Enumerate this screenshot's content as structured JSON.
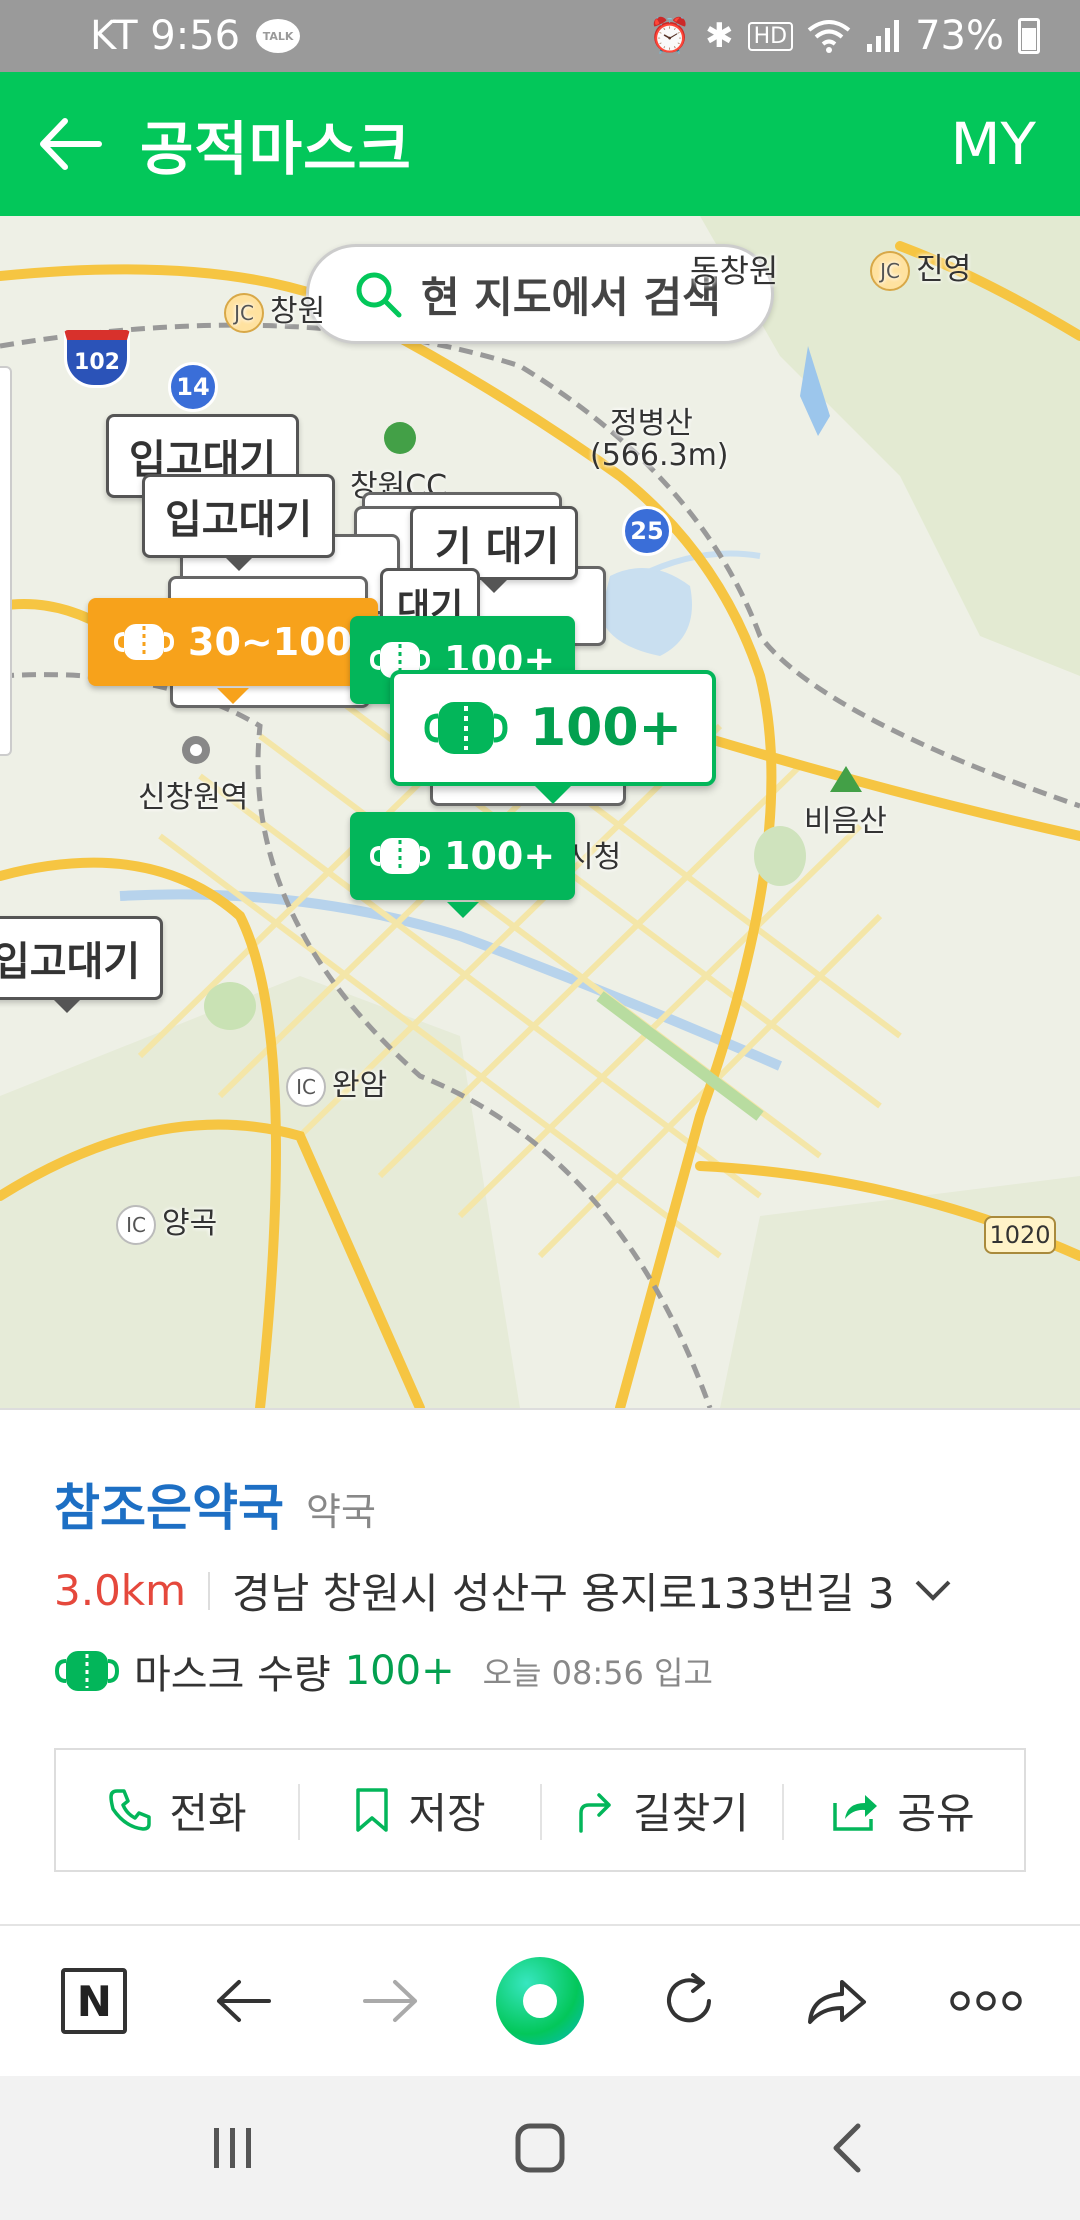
{
  "status_bar": {
    "carrier_time": "KT 9:56",
    "talk_badge": "TALK",
    "battery": "73%",
    "icons": [
      "alarm-icon",
      "bluetooth-icon",
      "hd-icon",
      "wifi-icon",
      "signal-icon",
      "battery-icon"
    ]
  },
  "app_bar": {
    "title": "공적마스크",
    "my_label": "MY"
  },
  "map": {
    "search_label": "현 지도에서 검색",
    "place_labels": {
      "jc_changwon": "창원",
      "jc_jinyoung": "진영",
      "dongchangwon": "동창원",
      "jeongbyeongsan": "정병산",
      "jeongbyeongsan_height": "(566.3m)",
      "changwon_cc": "창원CC",
      "sinchangwon_station": "신창원역",
      "bieumsan": "비음산",
      "sicheong": "시청",
      "dosicheong": "청",
      "wanam": "완암",
      "yanggok": "양곡",
      "ic_wanam": "IC",
      "ic_yanggok": "IC",
      "jc1": "JC",
      "jc2": "JC"
    },
    "route_shields": {
      "hw102": "102",
      "r14": "14",
      "r25": "25",
      "r1020": "1020"
    },
    "markers": {
      "waiting_1": "입고대기",
      "waiting_2": "입고대기",
      "waiting_3": "입고대기",
      "waiting_partial_a": "대기",
      "waiting_partial_b": "기",
      "waiting_partial_c": "대기",
      "orange": "30~100",
      "green_1": "100+",
      "green_selected": "100+",
      "green_2": "100+"
    },
    "colors": {
      "green": "#03b65a",
      "orange": "#f7a21b"
    }
  },
  "info_panel": {
    "name": "참조은약국",
    "category": "약국",
    "distance": "3.0km",
    "address": "경남 창원시 성산구 용지로133번길 3",
    "stock_label": "마스크 수량",
    "stock_value": "100+",
    "stock_time": "오늘 08:56 입고",
    "actions": [
      {
        "label": "전화",
        "icon": "phone-icon"
      },
      {
        "label": "저장",
        "icon": "bookmark-icon"
      },
      {
        "label": "길찾기",
        "icon": "directions-icon"
      },
      {
        "label": "공유",
        "icon": "share-icon"
      }
    ]
  },
  "browser_toolbar": {
    "icons": [
      "naver-home-icon",
      "back-icon",
      "forward-icon",
      "green-dot-icon",
      "refresh-icon",
      "share-arrow-icon",
      "more-icon"
    ],
    "naver_letter": "N"
  },
  "nav_bar": {
    "icons": [
      "recent-apps-icon",
      "home-icon",
      "back-nav-icon"
    ]
  },
  "accent_color": "#03c75a"
}
